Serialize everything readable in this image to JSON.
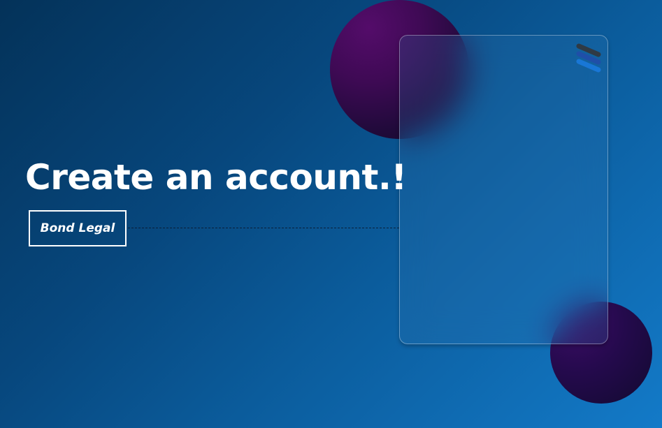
{
  "hero": {
    "headline": "Create an account.!"
  },
  "brand": {
    "label": "Bond Legal"
  },
  "logo": {
    "icon": "three-stripes-logo-icon",
    "colors": [
      "#2f3a45",
      "#1f4fa8",
      "#1977d6"
    ]
  },
  "theme": {
    "background_start": "#043259",
    "background_end": "#137ac8",
    "orb_color": "#540c6a",
    "orb_secondary": "#3a0c64"
  }
}
